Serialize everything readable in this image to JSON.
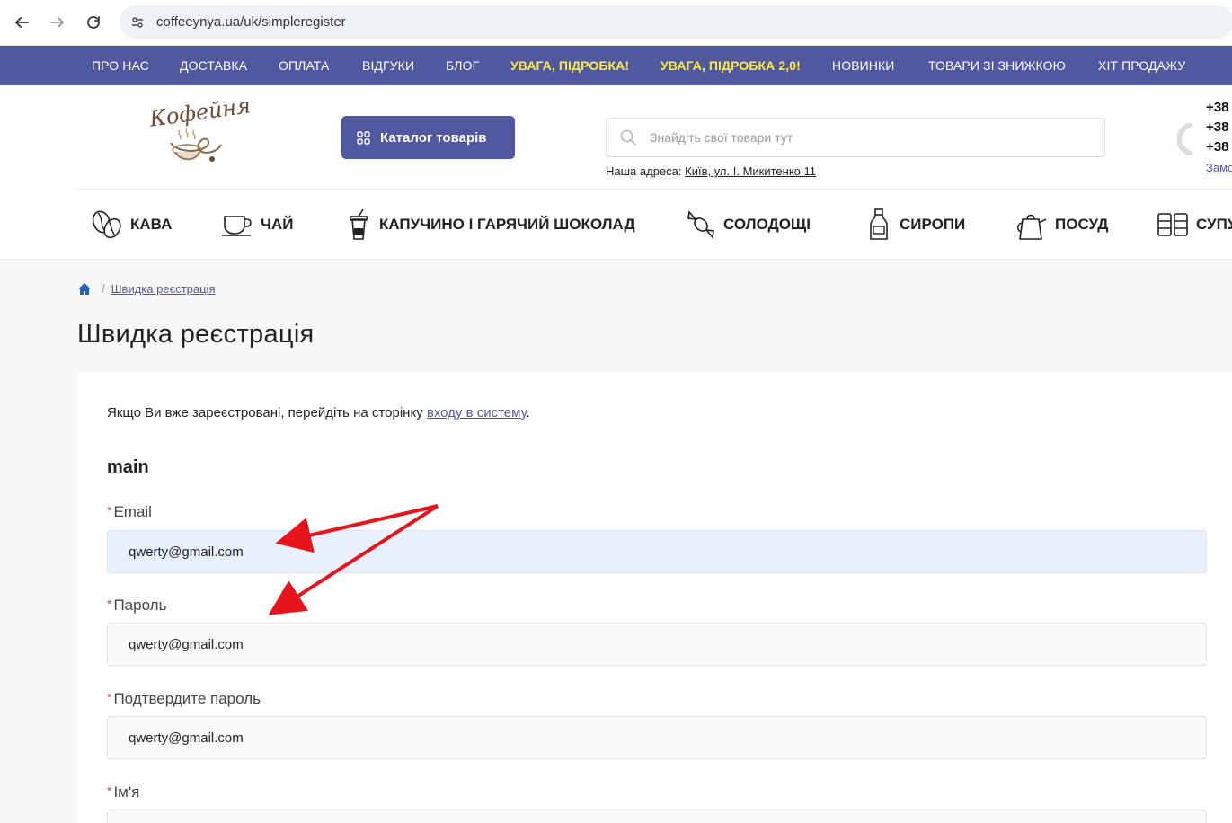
{
  "browser": {
    "url": "coffeeynya.ua/uk/simpleregister"
  },
  "top_menu": [
    {
      "label": "ПРО НАС",
      "warn": false
    },
    {
      "label": "ДОСТАВКА",
      "warn": false
    },
    {
      "label": "ОПЛАТА",
      "warn": false
    },
    {
      "label": "ВІДГУКИ",
      "warn": false
    },
    {
      "label": "БЛОГ",
      "warn": false
    },
    {
      "label": "УВАГА, ПІДРОБКА!",
      "warn": true
    },
    {
      "label": "УВАГА, ПІДРОБКА 2,0!",
      "warn": true
    },
    {
      "label": "НОВИНКИ",
      "warn": false
    },
    {
      "label": "ТОВАРИ ЗІ ЗНИЖКОЮ",
      "warn": false
    },
    {
      "label": "ХІТ ПРОДАЖУ",
      "warn": false
    }
  ],
  "header": {
    "logo_text": "Кофейня",
    "catalog_label": "Каталог товарів",
    "search_placeholder": "Знайдіть свої товари тут",
    "address_label": "Наша адреса:",
    "address_link": "Київ, ул. І. Микитенко 11",
    "phones": [
      "+38",
      "+38",
      "+38"
    ],
    "callback_link": "Замо"
  },
  "categories": [
    {
      "label": "КАВА",
      "icon": "coffee-beans-icon"
    },
    {
      "label": "ЧАЙ",
      "icon": "tea-cup-icon"
    },
    {
      "label": "КАПУЧИНО І ГАРЯЧИЙ ШОКОЛАД",
      "icon": "cappuccino-cup-icon"
    },
    {
      "label": "СОЛОДОЩІ",
      "icon": "candy-icon"
    },
    {
      "label": "СИРОПИ",
      "icon": "syrup-bottle-icon"
    },
    {
      "label": "ПОСУД",
      "icon": "kettle-icon"
    },
    {
      "label": "СУПУ",
      "icon": "cups-icon"
    }
  ],
  "breadcrumb": {
    "current": "Швидка реєстрація"
  },
  "page_title": "Швидка реєстрація",
  "form": {
    "intro_text": "Якщо Ви вже зареєстровані, перейдіть на сторінку",
    "intro_link": "входу в систему",
    "intro_end": ".",
    "section_title": "main",
    "required_mark": "*",
    "fields": [
      {
        "label": "Email",
        "value": "qwerty@gmail.com"
      },
      {
        "label": "Пароль",
        "value": "qwerty@gmail.com"
      },
      {
        "label": "Подтвердите пароль",
        "value": "qwerty@gmail.com"
      },
      {
        "label": "Ім'я",
        "value": ""
      }
    ]
  },
  "colors": {
    "brand": "#5059a0",
    "warning": "#ffec3d",
    "annotation_arrow": "#e8141b",
    "autofill": "#e8f0fe"
  }
}
